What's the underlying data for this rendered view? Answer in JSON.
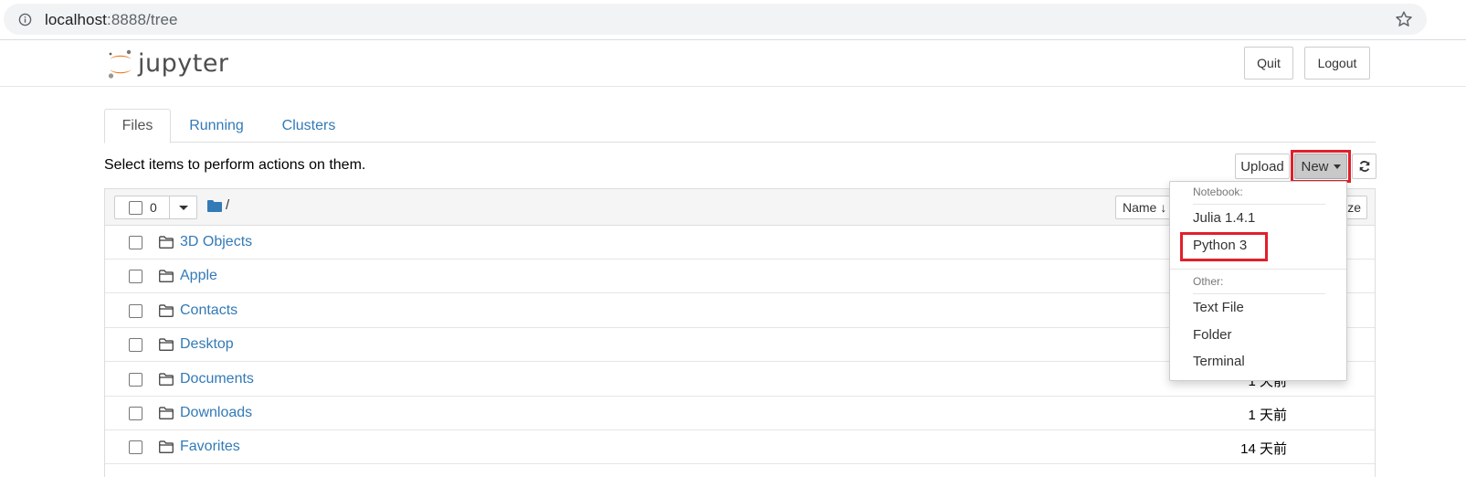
{
  "browser": {
    "url_host": "localhost",
    "url_path": ":8888/tree"
  },
  "header": {
    "logo_text": "jupyter",
    "quit_label": "Quit",
    "logout_label": "Logout"
  },
  "tabs": [
    {
      "label": "Files",
      "active": true
    },
    {
      "label": "Running",
      "active": false
    },
    {
      "label": "Clusters",
      "active": false
    }
  ],
  "toolbar": {
    "hint": "Select items to perform actions on them.",
    "upload_label": "Upload",
    "new_label": "New",
    "selected_count": "0",
    "root_path": "/",
    "name_sort_label": "Name",
    "size_sort_label": "ze"
  },
  "files": [
    {
      "name": "3D Objects",
      "modified": ""
    },
    {
      "name": "Apple",
      "modified": ""
    },
    {
      "name": "Contacts",
      "modified": ""
    },
    {
      "name": "Desktop",
      "modified": ""
    },
    {
      "name": "Documents",
      "modified": "1 天前"
    },
    {
      "name": "Downloads",
      "modified": "1 天前"
    },
    {
      "name": "Favorites",
      "modified": "14 天前"
    }
  ],
  "new_menu": {
    "notebook_header": "Notebook:",
    "notebook_items": [
      "Julia 1.4.1",
      "Python 3"
    ],
    "other_header": "Other:",
    "other_items": [
      "Text File",
      "Folder",
      "Terminal"
    ]
  },
  "colors": {
    "link": "#337ab7",
    "highlight": "#e0202b",
    "logo_orange": "#f37726"
  }
}
